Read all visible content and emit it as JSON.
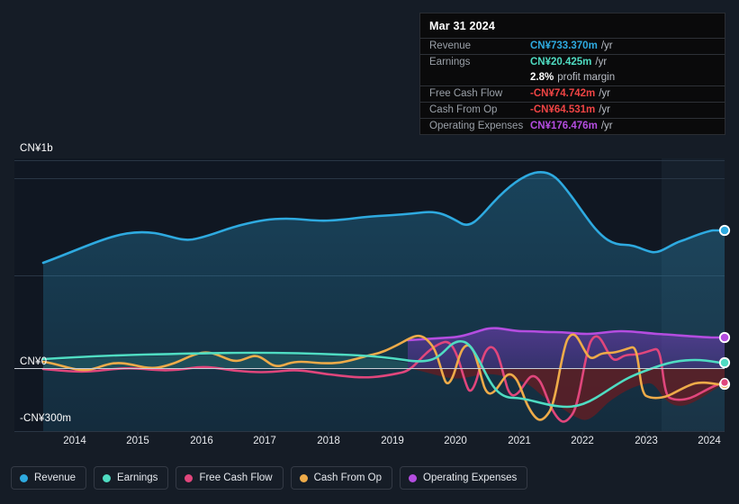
{
  "colors": {
    "background": "#151c26",
    "revenue": "#2eaae0",
    "earnings": "#4fdcc2",
    "free_cash_flow": "#e0467c",
    "cash_from_op": "#eeab49",
    "operating_expenses": "#b44de0",
    "zero_line": "#c9ced6",
    "grid": "#23303d",
    "negative_fill": "#5c1f26",
    "tooltip_bg": "#0a0a0b",
    "tooltip_border": "#2a2d33",
    "positive_text": "#2eaae0",
    "negative_text": "#ef4444"
  },
  "tooltip": {
    "title": "Mar 31 2024",
    "rows": [
      {
        "label": "Revenue",
        "value": "CN¥733.370m",
        "unit": "/yr",
        "color": "#2eaae0"
      },
      {
        "label": "Earnings",
        "value": "CN¥20.425m",
        "unit": "/yr",
        "color": "#4fdcc2"
      },
      {
        "label": "",
        "value": "2.8%",
        "unit": "profit margin",
        "color": "#ffffff",
        "sub": true
      },
      {
        "label": "Free Cash Flow",
        "value": "-CN¥74.742m",
        "unit": "/yr",
        "color": "#ef4444"
      },
      {
        "label": "Cash From Op",
        "value": "-CN¥64.531m",
        "unit": "/yr",
        "color": "#ef4444"
      },
      {
        "label": "Operating Expenses",
        "value": "CN¥176.476m",
        "unit": "/yr",
        "color": "#b44de0"
      }
    ]
  },
  "axes": {
    "y_top_label": "CN¥1b",
    "y_zero_label": "CN¥0",
    "y_bottom_label": "-CN¥300m",
    "x_ticks": [
      "2014",
      "2015",
      "2016",
      "2017",
      "2018",
      "2019",
      "2020",
      "2021",
      "2022",
      "2023",
      "2024"
    ]
  },
  "legend": {
    "items": [
      {
        "label": "Revenue",
        "color": "#2eaae0"
      },
      {
        "label": "Earnings",
        "color": "#4fdcc2"
      },
      {
        "label": "Free Cash Flow",
        "color": "#e0467c"
      },
      {
        "label": "Cash From Op",
        "color": "#eeab49"
      },
      {
        "label": "Operating Expenses",
        "color": "#b44de0"
      }
    ]
  },
  "chart_data": {
    "type": "line",
    "title": "",
    "xlabel": "",
    "ylabel": "CN¥",
    "currency": "CN¥",
    "ylim": [
      -300000000,
      1000000000
    ],
    "y_gridlines": [
      1000000000,
      916000000,
      545000000,
      0
    ],
    "x_range": [
      "2013-06",
      "2024-06"
    ],
    "grid": true,
    "legend_position": "bottom",
    "forecast_region_start": "2023-03",
    "series": [
      {
        "name": "Revenue",
        "color": "#2eaae0",
        "unit": "CN¥",
        "area_fill": true,
        "x": [
          "2013-06",
          "2014-03",
          "2014-09",
          "2015-03",
          "2015-09",
          "2016-03",
          "2016-09",
          "2017-03",
          "2017-09",
          "2018-03",
          "2018-09",
          "2019-03",
          "2019-09",
          "2020-03",
          "2020-09",
          "2021-03",
          "2021-09",
          "2022-03",
          "2022-09",
          "2023-03",
          "2023-09",
          "2024-03"
        ],
        "values": [
          495000000,
          560000000,
          620000000,
          648000000,
          630000000,
          655000000,
          690000000,
          708000000,
          700000000,
          706000000,
          715000000,
          722000000,
          735000000,
          700000000,
          790000000,
          930000000,
          860000000,
          640000000,
          608000000,
          640000000,
          700000000,
          733370000
        ]
      },
      {
        "name": "Earnings",
        "color": "#4fdcc2",
        "unit": "CN¥",
        "x": [
          "2013-06",
          "2014-03",
          "2015-03",
          "2016-03",
          "2017-03",
          "2018-03",
          "2019-03",
          "2019-09",
          "2020-03",
          "2020-09",
          "2021-03",
          "2021-09",
          "2022-03",
          "2022-09",
          "2023-03",
          "2023-09",
          "2024-03"
        ],
        "values": [
          18000000,
          20000000,
          22000000,
          24000000,
          25000000,
          22000000,
          14000000,
          -4000000,
          30000000,
          -42000000,
          -85000000,
          -95000000,
          -88000000,
          -40000000,
          5000000,
          18000000,
          20425000
        ]
      },
      {
        "name": "Free Cash Flow",
        "color": "#e0467c",
        "unit": "CN¥",
        "x": [
          "2013-06",
          "2014-03",
          "2015-03",
          "2016-03",
          "2017-03",
          "2018-03",
          "2018-09",
          "2019-03",
          "2019-09",
          "2020-03",
          "2020-06",
          "2020-09",
          "2021-03",
          "2021-06",
          "2021-09",
          "2022-03",
          "2022-09",
          "2023-03",
          "2023-09",
          "2024-03"
        ],
        "values": [
          -5000000,
          -10000000,
          -3000000,
          -8000000,
          6000000,
          -4000000,
          -22000000,
          -30000000,
          95000000,
          -55000000,
          60000000,
          -70000000,
          -48000000,
          -185000000,
          100000000,
          55000000,
          75000000,
          -160000000,
          -150000000,
          -74742000
        ]
      },
      {
        "name": "Cash From Op",
        "color": "#eeab49",
        "unit": "CN¥",
        "x": [
          "2013-06",
          "2014-03",
          "2015-03",
          "2016-03",
          "2017-03",
          "2018-03",
          "2018-09",
          "2019-03",
          "2019-09",
          "2020-03",
          "2020-06",
          "2020-09",
          "2021-03",
          "2021-06",
          "2021-09",
          "2022-03",
          "2022-09",
          "2023-03",
          "2023-09",
          "2024-03"
        ],
        "values": [
          10000000,
          2000000,
          12000000,
          5000000,
          30000000,
          12000000,
          -5000000,
          -15000000,
          105000000,
          -40000000,
          72000000,
          -55000000,
          -35000000,
          -160000000,
          112000000,
          68000000,
          88000000,
          -140000000,
          -132000000,
          -64531000
        ]
      },
      {
        "name": "Operating Expenses",
        "color": "#b44de0",
        "unit": "CN¥",
        "area_fill": true,
        "x": [
          "2019-03",
          "2019-09",
          "2020-03",
          "2020-09",
          "2021-03",
          "2021-09",
          "2022-03",
          "2022-09",
          "2023-03",
          "2023-09",
          "2024-03"
        ],
        "values": [
          131000000,
          133000000,
          152000000,
          185000000,
          196000000,
          190000000,
          196000000,
          192000000,
          200000000,
          188000000,
          176476000
        ]
      }
    ]
  }
}
